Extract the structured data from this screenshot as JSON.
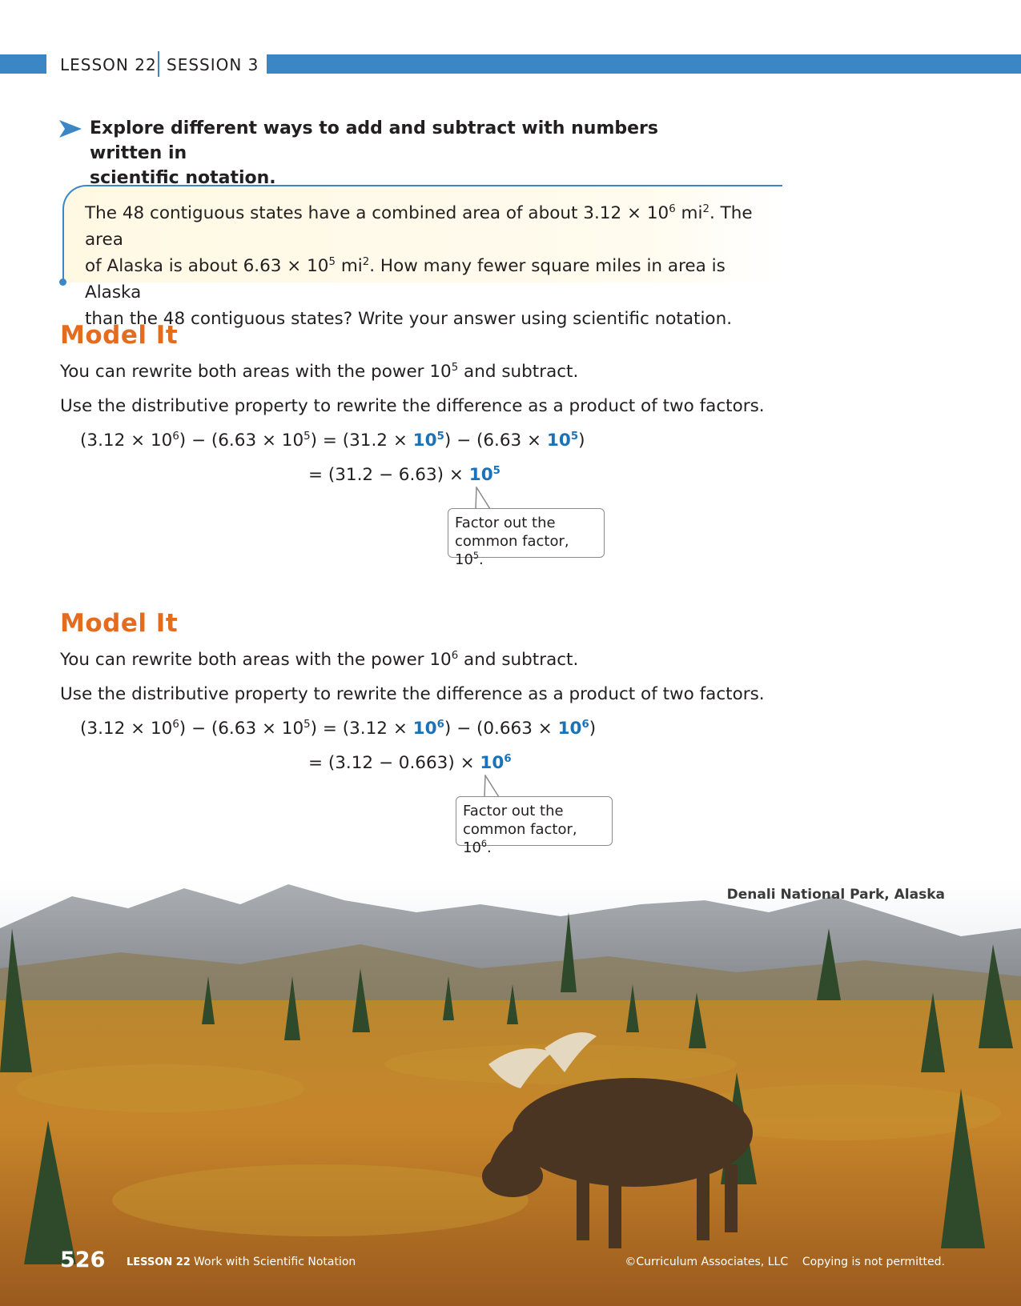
{
  "header": {
    "lesson": "LESSON 22",
    "session": "SESSION 3"
  },
  "explore": {
    "text_line1": "Explore different ways to add and subtract with numbers written in",
    "text_line2": "scientific notation."
  },
  "problem": {
    "line1_a": "The 48 contiguous states have a combined area of about 3.12 × 10",
    "line1_exp": "6",
    "line1_b": " mi",
    "line1_sq": "2",
    "line1_c": ". The area",
    "line2_a": "of Alaska is about 6.63 × 10",
    "line2_exp": "5",
    "line2_b": " mi",
    "line2_sq": "2",
    "line2_c": ". How many fewer square miles in area is Alaska",
    "line3": "than the 48 contiguous states? Write your answer using scientific notation."
  },
  "model1": {
    "title": "Model It",
    "line1_a": "You can rewrite both areas with the power 10",
    "line1_exp": "5",
    "line1_b": " and subtract.",
    "line2": "Use the distributive property to rewrite the difference as a product of two factors.",
    "eq1": {
      "p1": "(3.12 × 10",
      "e1": "6",
      "p2": ") − (6.63 × 10",
      "e2": "5",
      "p3": ") = (31.2 × ",
      "b1": "10",
      "be1": "5",
      "p4": ") − (6.63 × ",
      "b2": "10",
      "be2": "5",
      "p5": ")"
    },
    "eq2": {
      "p1": "= (31.2 − 6.63) × ",
      "b1": "10",
      "be1": "5"
    },
    "callout_line1": "Factor out the",
    "callout_line2_a": "common factor, 10",
    "callout_exp": "5",
    "callout_line2_b": "."
  },
  "model2": {
    "title": "Model It",
    "line1_a": "You can rewrite both areas with the power 10",
    "line1_exp": "6",
    "line1_b": " and subtract.",
    "line2": "Use the distributive property to rewrite the difference as a product of two factors.",
    "eq1": {
      "p1": "(3.12 × 10",
      "e1": "6",
      "p2": ") − (6.63 × 10",
      "e2": "5",
      "p3": ") = (3.12 × ",
      "b1": "10",
      "be1": "6",
      "p4": ") − (0.663 × ",
      "b2": "10",
      "be2": "6",
      "p5": ")"
    },
    "eq2": {
      "p1": "= (3.12 − 0.663) × ",
      "b1": "10",
      "be1": "6"
    },
    "callout_line1": "Factor out the",
    "callout_line2_a": "common factor, 10",
    "callout_exp": "6",
    "callout_line2_b": "."
  },
  "photo": {
    "caption": "Denali National Park, Alaska"
  },
  "footer": {
    "page_number": "526",
    "lesson": "LESSON 22",
    "title": "Work with Scientific Notation",
    "copyright": "©Curriculum Associates, LLC    Copying is not permitted."
  },
  "colors": {
    "band": "#3b87c6",
    "model_title": "#e36c1e",
    "emphasis_blue": "#1a73b8"
  }
}
